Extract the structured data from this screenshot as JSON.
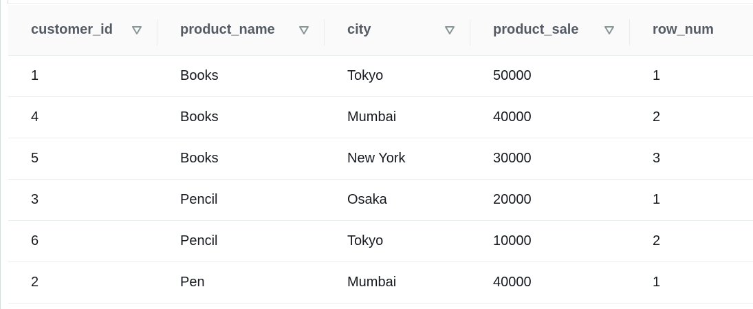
{
  "table": {
    "columns": [
      {
        "label": "customer_id",
        "sortable": true
      },
      {
        "label": "product_name",
        "sortable": true
      },
      {
        "label": "city",
        "sortable": true
      },
      {
        "label": "product_sale",
        "sortable": true
      },
      {
        "label": "row_num",
        "sortable": false
      }
    ],
    "rows": [
      [
        "1",
        "Books",
        "Tokyo",
        "50000",
        "1"
      ],
      [
        "4",
        "Books",
        "Mumbai",
        "40000",
        "2"
      ],
      [
        "5",
        "Books",
        "New York",
        "30000",
        "3"
      ],
      [
        "3",
        "Pencil",
        "Osaka",
        "20000",
        "1"
      ],
      [
        "6",
        "Pencil",
        "Tokyo",
        "10000",
        "2"
      ],
      [
        "2",
        "Pen",
        "Mumbai",
        "40000",
        "1"
      ]
    ]
  },
  "colors": {
    "header_bg": "#fafafa",
    "header_text": "#545b64",
    "cell_text": "#16191f",
    "border": "#eaeded",
    "sort_icon": "#879596"
  }
}
